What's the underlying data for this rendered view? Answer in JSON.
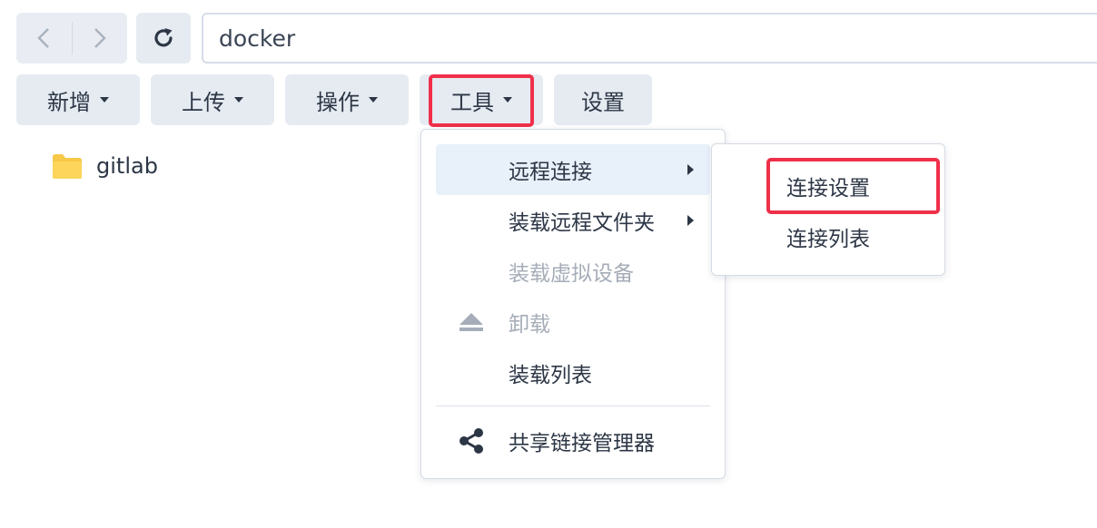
{
  "toolbar": {
    "back_icon": "chevron-left-icon",
    "forward_icon": "chevron-right-icon",
    "refresh_icon": "refresh-icon",
    "path": "docker",
    "buttons": {
      "create": "新增",
      "upload": "上传",
      "action": "操作",
      "tools": "工具",
      "settings": "设置"
    }
  },
  "files": [
    {
      "name": "gitlab",
      "icon": "folder-icon"
    }
  ],
  "tools_menu": {
    "items": [
      {
        "label": "远程连接",
        "submenu": true,
        "state": "active"
      },
      {
        "label": "装载远程文件夹",
        "submenu": true,
        "state": "normal"
      },
      {
        "label": "装载虚拟设备",
        "state": "disabled"
      },
      {
        "label": "卸载",
        "icon": "eject-icon",
        "state": "disabled"
      },
      {
        "label": "装载列表",
        "state": "normal"
      },
      {
        "label": "共享链接管理器",
        "icon": "share-icon",
        "state": "normal"
      }
    ]
  },
  "remote_submenu": {
    "items": [
      {
        "label": "连接设置",
        "highlighted": true
      },
      {
        "label": "连接列表"
      }
    ]
  },
  "colors": {
    "highlight": "#f0304a",
    "folder": "#f7c948",
    "active_row": "#e8f0fa"
  }
}
